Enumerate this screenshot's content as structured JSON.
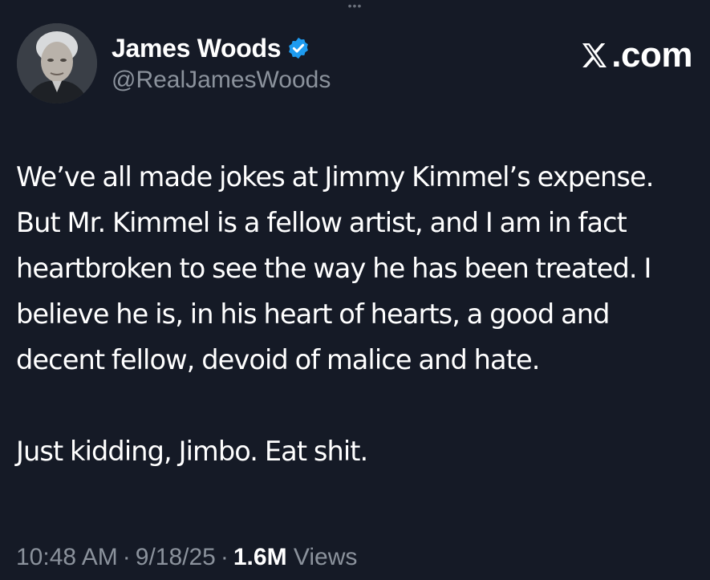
{
  "window": {
    "drag_handle": "•••"
  },
  "author": {
    "display_name": "James Woods",
    "handle": "@RealJamesWoods",
    "verified": true,
    "avatar_icon": "profile-photo",
    "verified_icon": "verified-badge-icon",
    "verified_color": "#1d9bf0"
  },
  "brand": {
    "label": ".com",
    "icon": "x-logo-icon"
  },
  "tweet": {
    "paragraphs": [
      "We’ve all made jokes at Jimmy Kimmel’s expense. But Mr. Kimmel is a fellow artist, and I am in fact heartbroken to see the way he has been treated. I believe he is, in his heart of hearts, a good and decent fellow, devoid of malice and hate.",
      "Just kidding, Jimbo. Eat shit."
    ]
  },
  "meta": {
    "time": "10:48 AM",
    "separator": "·",
    "date": "9/18/25",
    "views_count": "1.6M",
    "views_label": "Views"
  },
  "colors": {
    "background": "#151a26",
    "text_primary": "#ffffff",
    "text_secondary": "#8b929c",
    "accent": "#1d9bf0"
  }
}
